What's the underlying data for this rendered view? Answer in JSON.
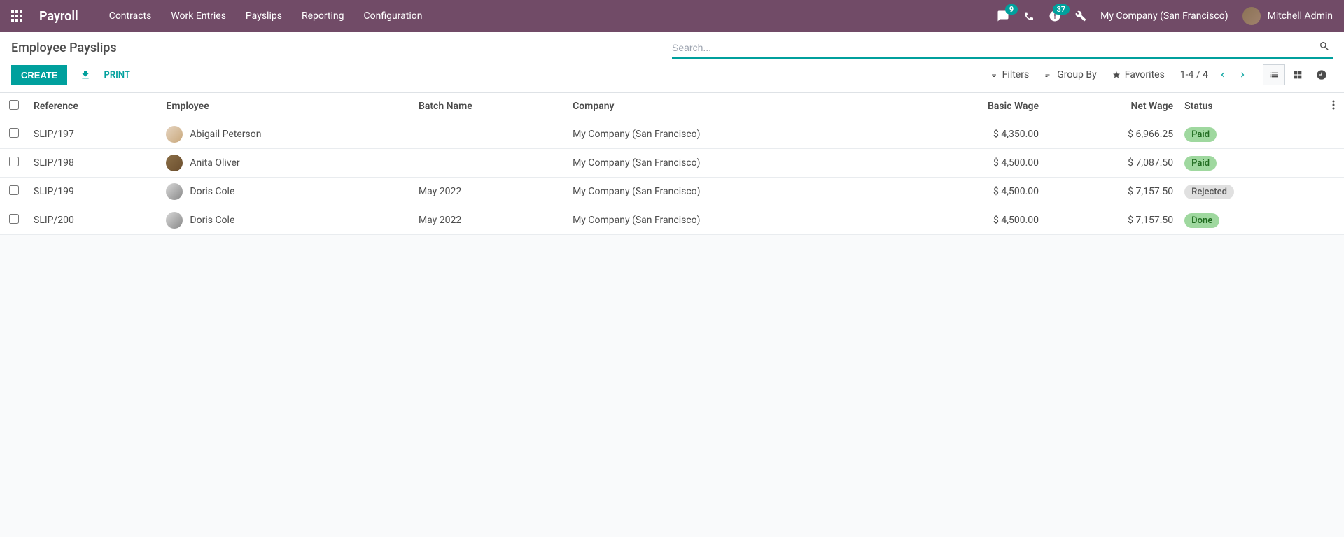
{
  "header": {
    "app_name": "Payroll",
    "menu": [
      "Contracts",
      "Work Entries",
      "Payslips",
      "Reporting",
      "Configuration"
    ],
    "messages_badge": "9",
    "activities_badge": "37",
    "company": "My Company (San Francisco)",
    "user": "Mitchell Admin"
  },
  "control": {
    "breadcrumb": "Employee Payslips",
    "search_placeholder": "Search...",
    "create_label": "CREATE",
    "print_label": "PRINT",
    "filters_label": "Filters",
    "groupby_label": "Group By",
    "favorites_label": "Favorites",
    "pager_text": "1-4 / 4"
  },
  "columns": {
    "reference": "Reference",
    "employee": "Employee",
    "batch": "Batch Name",
    "company": "Company",
    "basic_wage": "Basic Wage",
    "net_wage": "Net Wage",
    "status": "Status"
  },
  "rows": [
    {
      "reference": "SLIP/197",
      "employee": "Abigail Peterson",
      "batch": "",
      "company": "My Company (San Francisco)",
      "basic_wage": "$ 4,350.00",
      "net_wage": "$ 6,966.25",
      "status": "Paid",
      "status_class": "status-paid",
      "avatar_class": "a1"
    },
    {
      "reference": "SLIP/198",
      "employee": "Anita Oliver",
      "batch": "",
      "company": "My Company (San Francisco)",
      "basic_wage": "$ 4,500.00",
      "net_wage": "$ 7,087.50",
      "status": "Paid",
      "status_class": "status-paid",
      "avatar_class": "a2"
    },
    {
      "reference": "SLIP/199",
      "employee": "Doris Cole",
      "batch": "May 2022",
      "company": "My Company (San Francisco)",
      "basic_wage": "$ 4,500.00",
      "net_wage": "$ 7,157.50",
      "status": "Rejected",
      "status_class": "status-rejected",
      "avatar_class": "a3"
    },
    {
      "reference": "SLIP/200",
      "employee": "Doris Cole",
      "batch": "May 2022",
      "company": "My Company (San Francisco)",
      "basic_wage": "$ 4,500.00",
      "net_wage": "$ 7,157.50",
      "status": "Done",
      "status_class": "status-done",
      "avatar_class": "a3"
    }
  ]
}
